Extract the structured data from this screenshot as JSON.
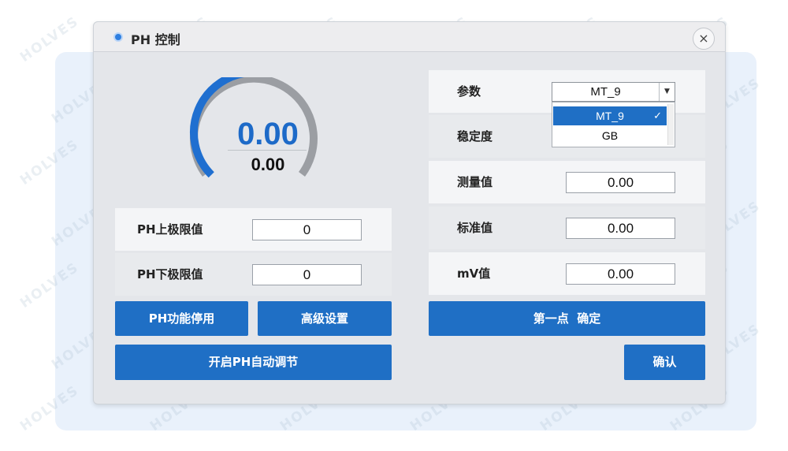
{
  "dialog": {
    "title": "PH 控制",
    "close_label": "×"
  },
  "gauge": {
    "value": "0.00",
    "sub_value": "0.00",
    "fill_fraction": 0.5,
    "accent_color": "#1d6ac8"
  },
  "left": {
    "upper_limit_label": "PH上极限值",
    "upper_limit_value": "0",
    "lower_limit_label": "PH下极限值",
    "lower_limit_value": "0",
    "disable_button": "PH功能停用",
    "advanced_button": "高级设置",
    "auto_adjust_button": "开启PH自动调节"
  },
  "right": {
    "param_label": "参数",
    "param_selected": "MT_9",
    "param_options": [
      "MT_9",
      "GB"
    ],
    "stability_label": "稳定度",
    "measured_label": "测量值",
    "measured_value": "0.00",
    "standard_label": "标准值",
    "standard_value": "0.00",
    "mv_label": "mV值",
    "mv_value": "0.00",
    "first_point_button": "第一点  确定",
    "confirm_button": "确认"
  },
  "watermark_text": "HOLVES",
  "icons": {
    "title": "radio-dot-icon",
    "close": "close-icon",
    "dropdown": "chevron-down-icon",
    "check": "check-icon"
  }
}
